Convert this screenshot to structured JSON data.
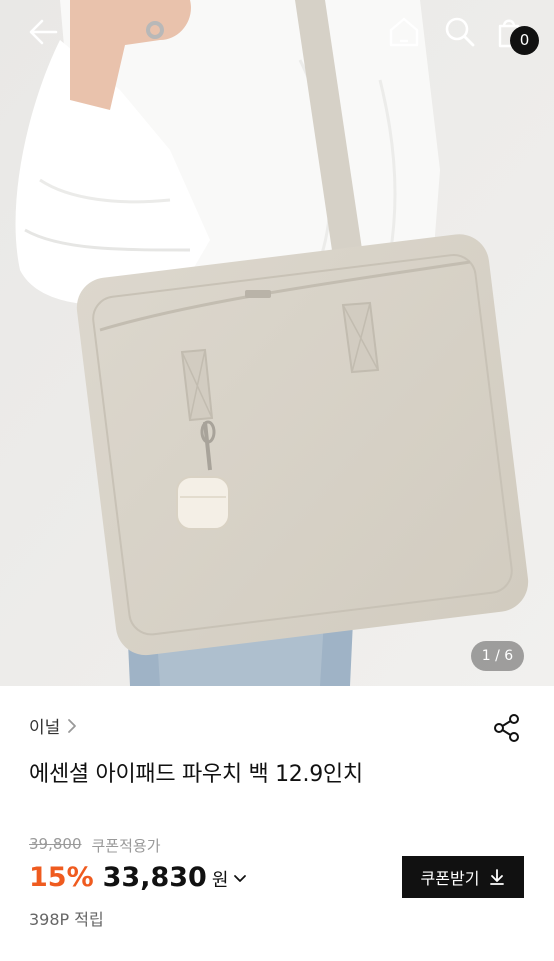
{
  "header": {
    "cart_count": "0",
    "icons": [
      "back-arrow-icon",
      "home-icon",
      "search-icon",
      "shopping-bag-icon"
    ]
  },
  "gallery": {
    "pager": "1 / 6",
    "image_subject": "person carrying a beige laptop shoulder bag with a white earbud case charm"
  },
  "product": {
    "brand": "이널",
    "title": "에센셜 아이패드 파우치 백 12.9인치",
    "original_price": "39,800",
    "coupon_applied_label": "쿠폰적용가",
    "discount": "15%",
    "sale_price": "33,830",
    "currency": "원",
    "points": "398P 적립",
    "coupon_button": "쿠폰받기"
  },
  "colors": {
    "discount": "#ef5b1f",
    "button_bg": "#111111"
  }
}
